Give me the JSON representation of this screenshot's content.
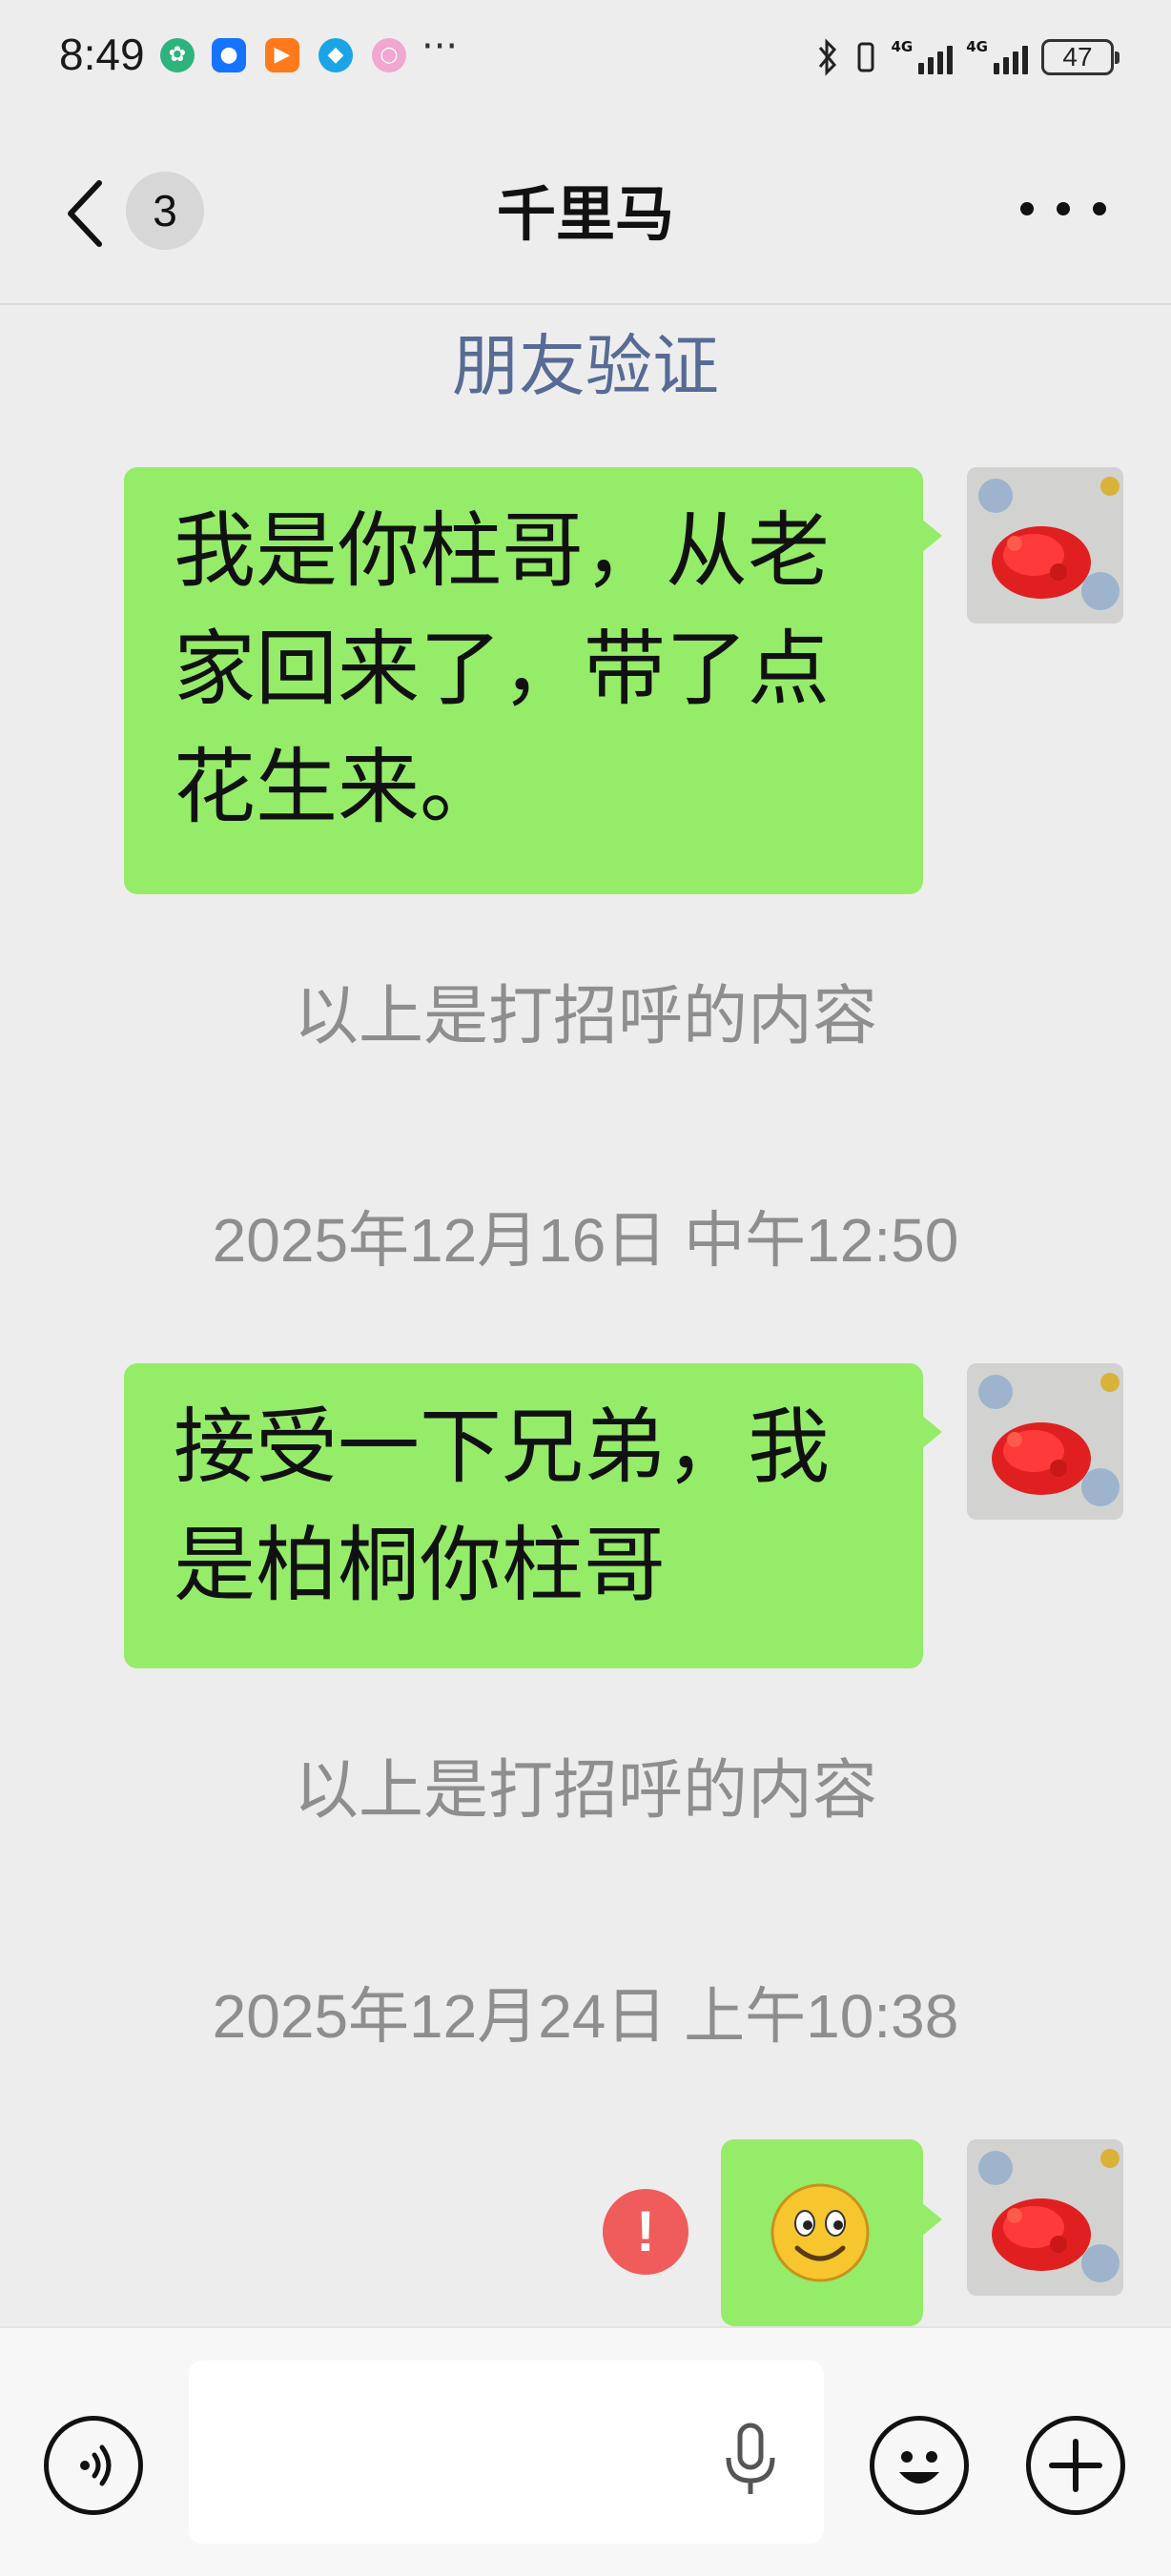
{
  "status_bar": {
    "time": "8:49",
    "more_dots": "···",
    "network_1": "4G",
    "network_2": "4G",
    "battery": "47"
  },
  "header": {
    "unread_count": "3",
    "title": "千里马"
  },
  "verify_link": "朋友验证",
  "messages": [
    {
      "text": "我是你柱哥，从老家回来了，带了点花生来。"
    },
    {
      "text": "接受一下兄弟，我是柏桐你柱哥"
    }
  ],
  "system": {
    "greeting_note_1": "以上是打招呼的内容",
    "greeting_note_2": "以上是打招呼的内容",
    "timestamp_1": "2025年12月16日 中午12:50",
    "timestamp_2": "2025年12月24日 上午10:38"
  },
  "failed_mark": "!",
  "colors": {
    "bubble_green": "#95ec69",
    "link_blue": "#576b95",
    "error_red": "#f05b5b",
    "background": "#ededed"
  },
  "icons": [
    "voice-mode-icon",
    "microphone-icon",
    "emoji-icon",
    "plus-icon",
    "back-arrow-icon",
    "more-options-icon"
  ]
}
